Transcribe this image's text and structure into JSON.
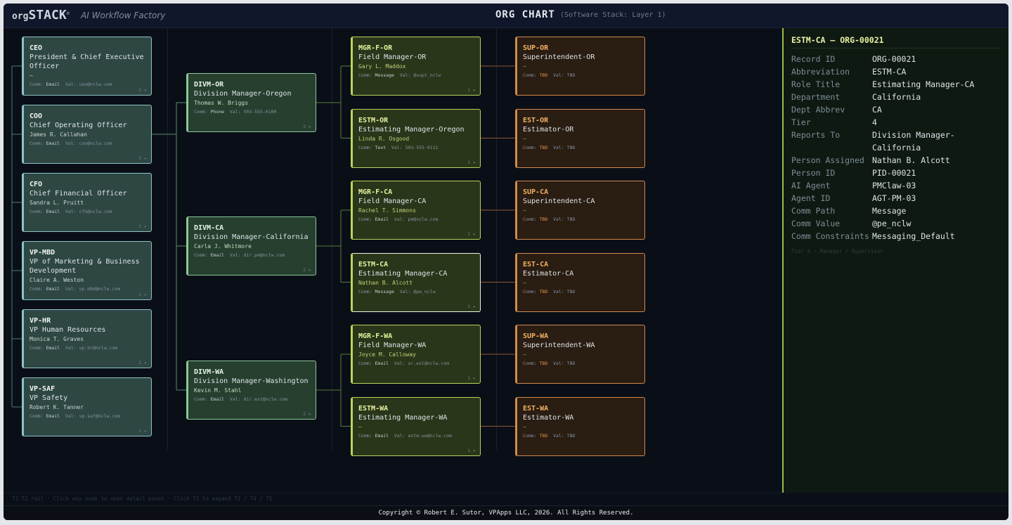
{
  "header": {
    "logo_small": "org",
    "logo_big": "STACK",
    "logo_mark": "®",
    "tagline": "AI Workflow Factory",
    "title": "ORG CHART",
    "subtitle": "(Software Stack: Layer 1)"
  },
  "tier1": [
    {
      "abbr": "CEO",
      "title": "President & Chief Executive Officer",
      "person": "—",
      "comm": "Email",
      "val": "ceo@nclw.com",
      "count": "5 ▸"
    },
    {
      "abbr": "COO",
      "title": "Chief Operating Officer",
      "person": "James R. Callahan",
      "comm": "Email",
      "val": "coo@nclw.com",
      "count": "3 ▸"
    },
    {
      "abbr": "CFO",
      "title": "Chief Financial Officer",
      "person": "Sandra L. Pruitt",
      "comm": "Email",
      "val": "cfo@nclw.com",
      "count": "2 ▸"
    },
    {
      "abbr": "VP-MBD",
      "title": "VP of Marketing & Business Development",
      "person": "Claire A. Weston",
      "comm": "Email",
      "val": "vp.mbd@nclw.com",
      "count": "2 ▸"
    },
    {
      "abbr": "VP-HR",
      "title": "VP Human Resources",
      "person": "Monica T. Graves",
      "comm": "Email",
      "val": "vp.hr@nclw.com",
      "count": "2 ▸"
    },
    {
      "abbr": "VP-SAF",
      "title": "VP Safety",
      "person": "Robert K. Tanner",
      "comm": "Email",
      "val": "vp.saf@nclw.com",
      "count": "3 ▸"
    }
  ],
  "tier2": [
    {
      "abbr": "DIVM-OR",
      "title": "Division Manager-Oregon",
      "person": "Thomas W. Briggs",
      "comm": "Phone",
      "val": "503-555-0100",
      "count": "2 ▸"
    },
    {
      "abbr": "DIVM-CA",
      "title": "Division Manager-California",
      "person": "Carla J. Whitmore",
      "comm": "Email",
      "val": "dir.pm@nclw.com",
      "count": "2 ▸"
    },
    {
      "abbr": "DIVM-WA",
      "title": "Division Manager-Washington",
      "person": "Kevin M. Stahl",
      "comm": "Email",
      "val": "dir.est@nclw.com",
      "count": "2 ▸"
    }
  ],
  "tier3": [
    {
      "abbr": "MGR-F-OR",
      "title": "Field Manager-OR",
      "person": "Gary L. Maddox",
      "comm": "Message",
      "val": "@supt_nclw",
      "count": "1 ▸"
    },
    {
      "abbr": "ESTM-OR",
      "title": "Estimating Manager-Oregon",
      "person": "Linda R. Osgood",
      "comm": "Text",
      "val": "503-555-0111",
      "count": "1 ▸"
    },
    {
      "abbr": "MGR-F-CA",
      "title": "Field Manager-CA",
      "person": "Rachel T. Simmons",
      "comm": "Email",
      "val": "pm@nclw.com",
      "count": "1 ▸"
    },
    {
      "abbr": "ESTM-CA",
      "title": "Estimating Manager-CA",
      "person": "Nathan B. Alcott",
      "comm": "Message",
      "val": "@pe_nclw",
      "count": "1 ▸"
    },
    {
      "abbr": "MGR-F-WA",
      "title": "Field Manager-WA",
      "person": "Joyce M. Calloway",
      "comm": "Email",
      "val": "sr.est@nclw.com",
      "count": "1 ▸"
    },
    {
      "abbr": "ESTM-WA",
      "title": "Estimating Manager-WA",
      "person": "—",
      "comm": "Email",
      "val": "estm.wa@nclw.com",
      "count": "1 ▸"
    }
  ],
  "tier4": [
    {
      "abbr": "SUP-OR",
      "title": "Superintendent-OR",
      "person": "—",
      "comm": "TBD",
      "val": "TBD"
    },
    {
      "abbr": "EST-OR",
      "title": "Estimator-OR",
      "person": "—",
      "comm": "TBD",
      "val": "TBD"
    },
    {
      "abbr": "SUP-CA",
      "title": "Superintendent-CA",
      "person": "—",
      "comm": "TBD",
      "val": "TBD"
    },
    {
      "abbr": "EST-CA",
      "title": "Estimator-CA",
      "person": "—",
      "comm": "TBD",
      "val": "TBD"
    },
    {
      "abbr": "SUP-WA",
      "title": "Superintendent-WA",
      "person": "—",
      "comm": "TBD",
      "val": "TBD"
    },
    {
      "abbr": "EST-WA",
      "title": "Estimator-WA",
      "person": "—",
      "comm": "TBD",
      "val": "TBD"
    }
  ],
  "labels": {
    "comm": "Comm:",
    "val": "Val:"
  },
  "detail": {
    "title": "ESTM-CA — ORG-00021",
    "rows": [
      {
        "label": "Record ID",
        "value": "ORG-00021"
      },
      {
        "label": "Abbreviation",
        "value": "ESTM-CA"
      },
      {
        "label": "Role Title",
        "value": "Estimating Manager-CA"
      },
      {
        "label": "Department",
        "value": "California"
      },
      {
        "label": "Dept Abbrev",
        "value": "CA"
      },
      {
        "label": "Tier",
        "value": "4"
      },
      {
        "label": "Reports To",
        "value": "Division Manager-California"
      },
      {
        "label": "Person Assigned",
        "value": "Nathan B. Alcott"
      },
      {
        "label": "Person ID",
        "value": "PID-00021"
      },
      {
        "label": "AI Agent",
        "value": "PMClaw-03"
      },
      {
        "label": "Agent ID",
        "value": "AGT-PM-03"
      },
      {
        "label": "Comm Path",
        "value": "Message"
      },
      {
        "label": "Comm Value",
        "value": "@pe_nclw"
      },
      {
        "label": "Comm Constraints",
        "value": "Messaging_Default"
      }
    ],
    "footnote": "Tier 4 — Manager / Supervisor"
  },
  "hint": "T1-T2 rail · Click any node to open detail panel · Click T2 to expand T3 / T4 / T5",
  "footer": "Copyright © Robert E. Sutor, VPApps LLC, 2026. All Rights Reserved.",
  "selected": "ESTM-CA"
}
